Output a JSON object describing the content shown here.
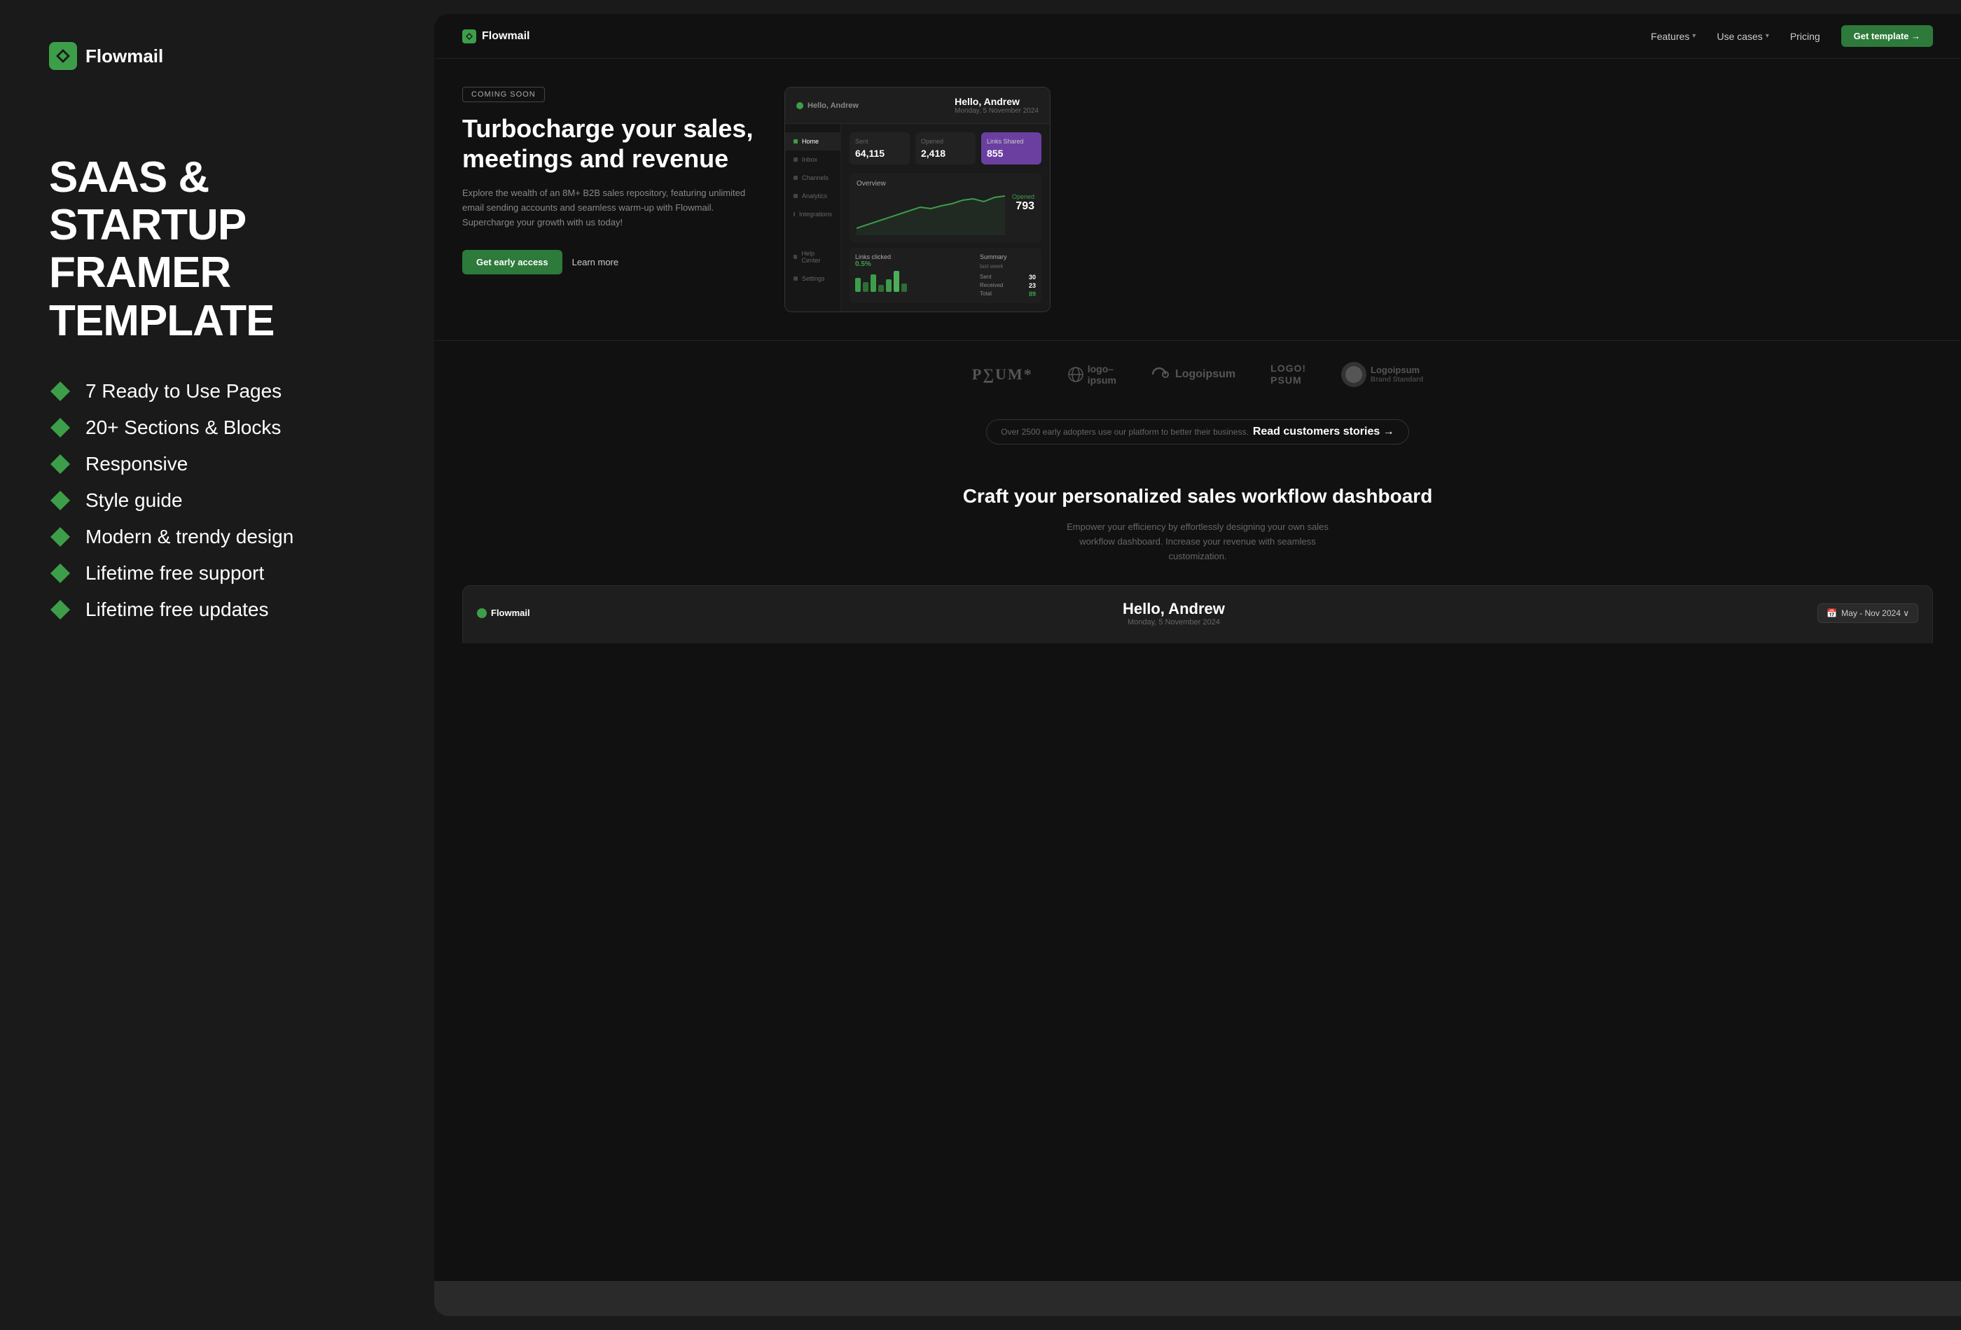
{
  "brand": {
    "name": "Flowmail",
    "logo_alt": "Flowmail logo"
  },
  "left_panel": {
    "main_heading_line1": "SAAS & STARTUP",
    "main_heading_line2": "FRAMER TEMPLATE",
    "features": [
      {
        "id": 1,
        "text": "7 Ready to Use Pages"
      },
      {
        "id": 2,
        "text": "20+ Sections & Blocks"
      },
      {
        "id": 3,
        "text": "Responsive"
      },
      {
        "id": 4,
        "text": "Style guide"
      },
      {
        "id": 5,
        "text": "Modern & trendy design"
      },
      {
        "id": 6,
        "text": "Lifetime free support"
      },
      {
        "id": 7,
        "text": "Lifetime free updates"
      }
    ]
  },
  "right_panel": {
    "nav": {
      "logo": "Flowmail",
      "links": [
        {
          "label": "Features",
          "has_dropdown": true
        },
        {
          "label": "Use cases",
          "has_dropdown": true
        },
        {
          "label": "Pricing",
          "has_dropdown": false
        }
      ],
      "cta": "Get template →"
    },
    "hero": {
      "badge": "COMING SOON",
      "title": "Turbocharge your sales, meetings and revenue",
      "description": "Explore the wealth of an 8M+ B2B sales repository, featuring unlimited email sending accounts and seamless warm-up with Flowmail. Supercharge your growth with us today!",
      "btn_primary": "Get early access",
      "btn_secondary": "Learn more"
    },
    "dashboard": {
      "greeting": "Hello, Andrew",
      "date": "Monday, 5 November 2024",
      "stats": [
        {
          "label": "Sent",
          "value": "64,115"
        },
        {
          "label": "Opened",
          "value": "2,418"
        },
        {
          "label": "Links Shared",
          "value": "855"
        }
      ],
      "overview_label": "Overview",
      "chart_label": "Opened",
      "chart_value": "793",
      "sidebar_items": [
        {
          "label": "Home",
          "active": true
        },
        {
          "label": "Inbox"
        },
        {
          "label": "Channels"
        },
        {
          "label": "Analytics"
        },
        {
          "label": "Integrations"
        },
        {
          "label": "Help Center"
        },
        {
          "label": "Settings"
        }
      ],
      "summary": {
        "title": "Summary",
        "subtitle": "last week",
        "sent": "30",
        "received": "23",
        "total": "89"
      },
      "links_clicked": "0.5%"
    },
    "logos": [
      "PSUM*",
      "logo–ipsum",
      "Logoipsum",
      "LOGO! PSUM",
      "Logoipsum Brand Standard"
    ],
    "social_proof": "Over 2500 early adopters use our platform to better their business.  Read customers stories →",
    "bottom_section": {
      "title": "Craft your personalized sales workflow dashboard",
      "description": "Empower your efficiency by effortlessly designing your own sales workflow dashboard. Increase your revenue with seamless customization."
    },
    "bottom_dashboard": {
      "logo": "Flowmail",
      "greeting": "Hello, Andrew",
      "date": "Monday, 5 November 2024",
      "date_range": "May - Nov 2024 ∨"
    }
  },
  "colors": {
    "bg_dark": "#1a1a1a",
    "green_accent": "#3d9e4a",
    "green_btn": "#2d7a3a",
    "text_muted": "#888888",
    "border": "#2a2a2a"
  }
}
